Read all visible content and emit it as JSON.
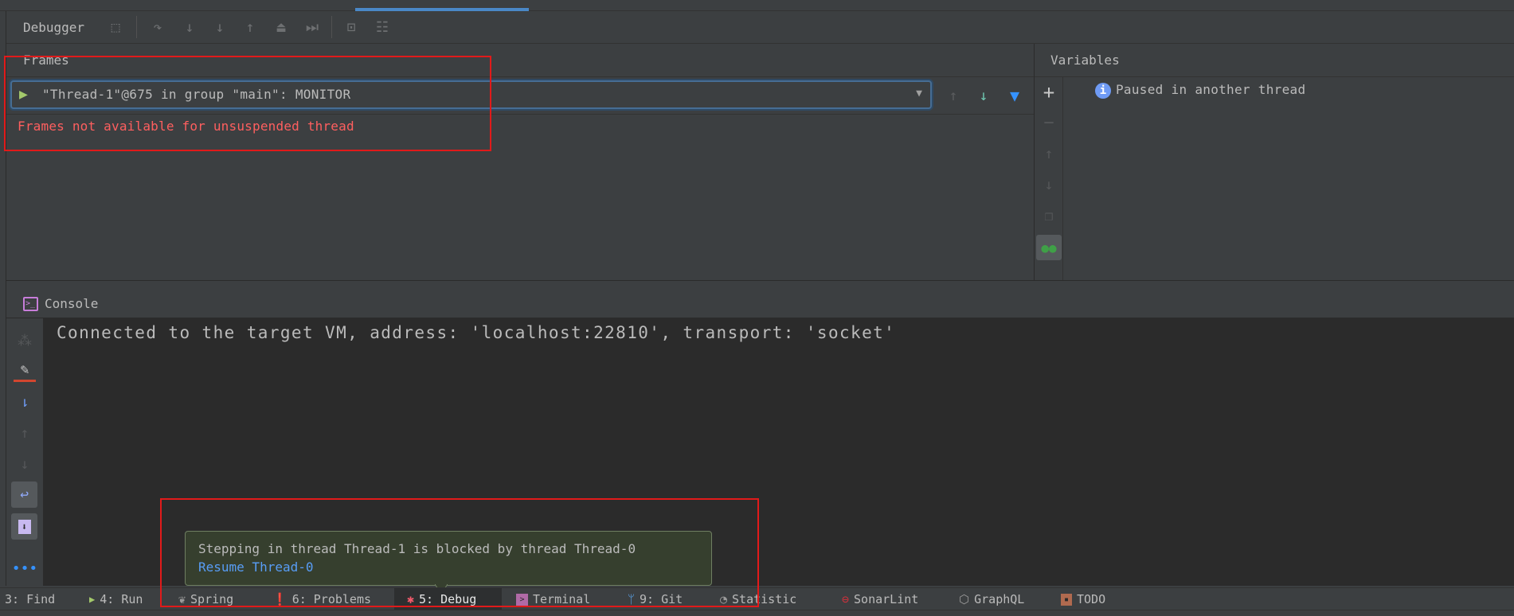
{
  "toolbar": {
    "title": "Debugger"
  },
  "frames": {
    "title": "Frames",
    "thread_selected": "\"Thread-1\"@675 in group \"main\": MONITOR",
    "error": "Frames not available for unsuspended thread"
  },
  "variables": {
    "title": "Variables",
    "message": "Paused in another thread"
  },
  "console": {
    "title": "Console",
    "lines": [
      "Connected to the target VM, address: 'localhost:22810', transport: 'socket'"
    ]
  },
  "notification": {
    "message": "Stepping in thread Thread-1 is blocked by thread Thread-0",
    "action": "Resume Thread-0"
  },
  "statusbar": {
    "items": [
      {
        "label": "3: Find",
        "icon": "search-icon"
      },
      {
        "label": "4: Run",
        "icon": "run-icon"
      },
      {
        "label": "Spring",
        "icon": "spring-leaf-icon"
      },
      {
        "label": "6: Problems",
        "icon": "warning-icon"
      },
      {
        "label": "5: Debug",
        "icon": "bug-icon",
        "active": true
      },
      {
        "label": "Terminal",
        "icon": "terminal-icon"
      },
      {
        "label": "9: Git",
        "icon": "git-branch-icon"
      },
      {
        "label": "Statistic",
        "icon": "pie-chart-icon"
      },
      {
        "label": "SonarLint",
        "icon": "sonarlint-icon"
      },
      {
        "label": "GraphQL",
        "icon": "graphql-icon"
      },
      {
        "label": "TODO",
        "icon": "todo-icon"
      }
    ]
  },
  "colors": {
    "accent": "#4a88c7",
    "error": "#ff5f5f",
    "link": "#589df6",
    "tooltip_bg": "#363f2e",
    "highlight": "#e11a1a"
  }
}
